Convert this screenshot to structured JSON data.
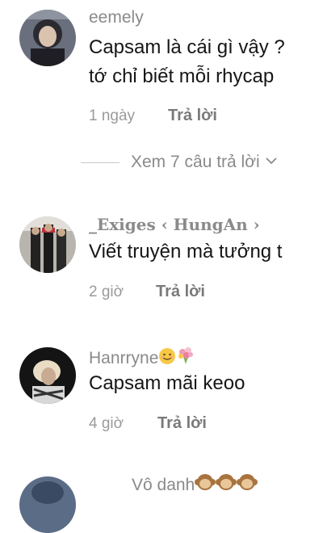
{
  "comments": [
    {
      "username": "eemely",
      "text_lines": [
        "Capsam là cái gì vậy ?",
        "tớ chỉ biết mỗi rhycap"
      ],
      "time": "1 ngày",
      "reply_label": "Trả lời"
    },
    {
      "username": "_Exiges ‹ HungAn ›",
      "text_lines": [
        "Viết truyện mà tưởng t"
      ],
      "time": "2 giờ",
      "reply_label": "Trả lời"
    },
    {
      "username": "Hanrryne",
      "username_emojis": [
        "smiling-face-icon",
        "bouquet-icon"
      ],
      "text_lines": [
        "Capsam mãi keoo"
      ],
      "time": "4 giờ",
      "reply_label": "Trả lời"
    },
    {
      "username": "Vô danh",
      "username_emojis": [
        "monkey-face-icon",
        "monkey-face-icon",
        "monkey-face-icon"
      ]
    }
  ],
  "view_replies": {
    "label": "Xem 7 câu trả lời",
    "icon": "chevron-down-icon"
  }
}
